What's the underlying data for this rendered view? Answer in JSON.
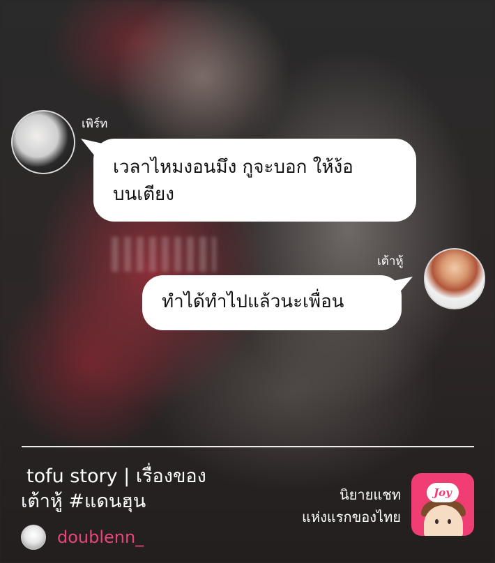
{
  "messages": [
    {
      "sender": "เพิร์ท",
      "text_line1": "เวลาไหมงอนมึง กูจะบอก ให้ง้อ",
      "text_line2": "บนเตียง"
    },
    {
      "sender": "เต้าหู้",
      "text": "ทำได้ทำไปแล้วนะเพื่อน"
    }
  ],
  "footer": {
    "title_line1": "tofu story | เรื่องของ",
    "title_line2": "เต้าหู้ #แดนฮุน",
    "author": "doublenn_",
    "promo_line1": "นิยายแชท",
    "promo_line2": "แห่งแรกของไทย",
    "logo_text": "Joy"
  },
  "colors": {
    "author": "#e8457a",
    "logo_bg": "#f03d74",
    "bubble": "#ffffff"
  },
  "icons": {
    "sender1_avatar": "avatar",
    "sender2_avatar": "avatar",
    "author_avatar": "avatar",
    "app_logo": "joy-logo"
  }
}
